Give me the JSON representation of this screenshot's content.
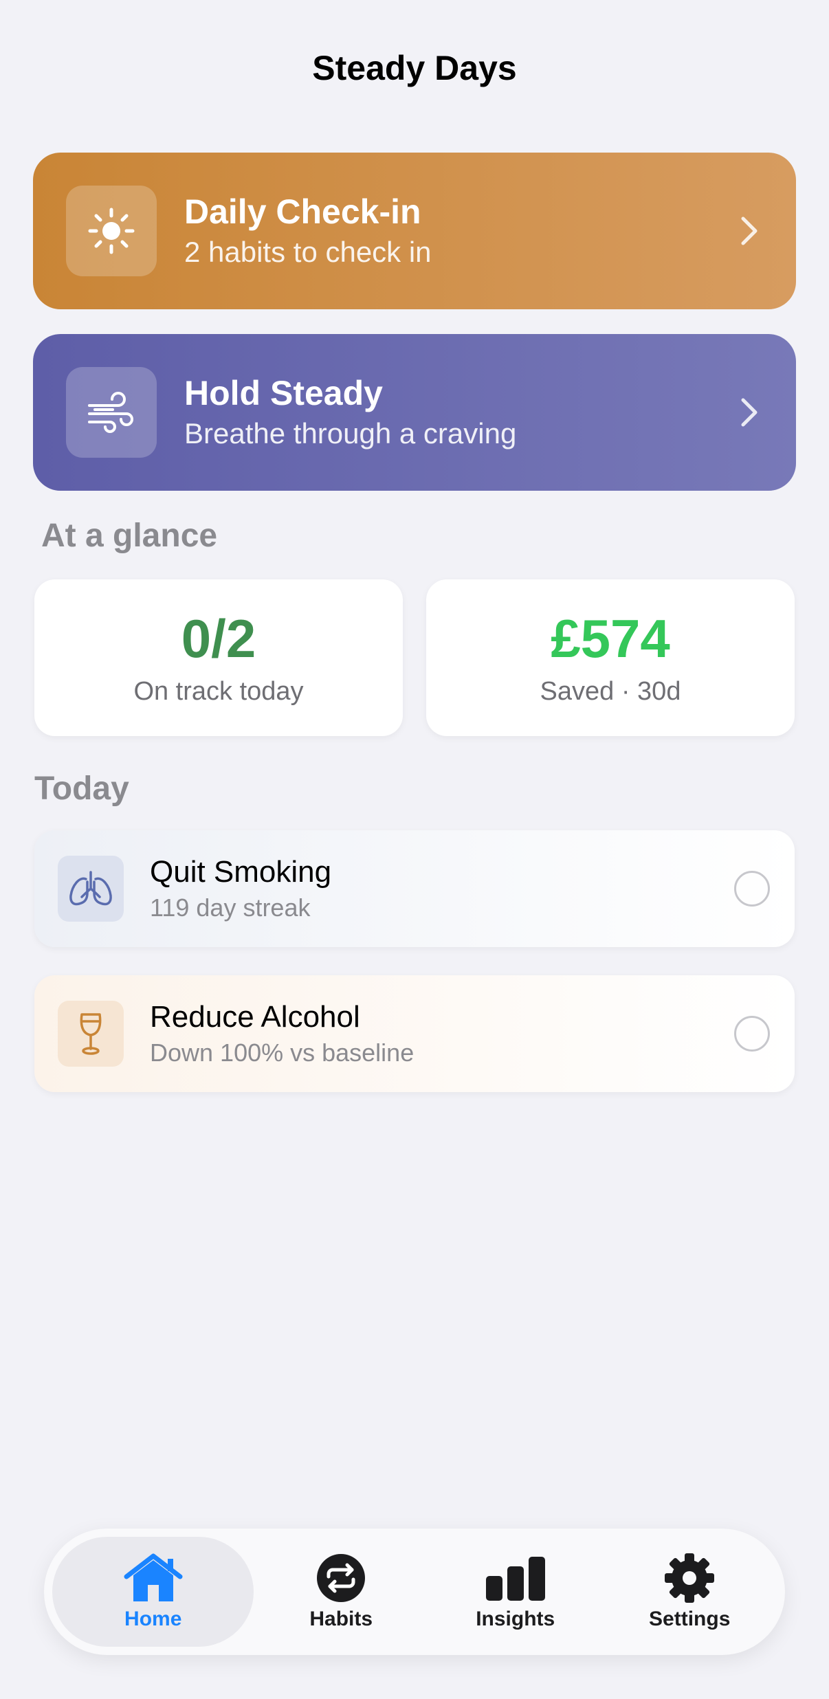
{
  "header": {
    "title": "Steady Days"
  },
  "cards": {
    "checkin": {
      "title": "Daily Check-in",
      "subtitle": "2 habits to check in",
      "icon": "sun-icon"
    },
    "hold": {
      "title": "Hold Steady",
      "subtitle": "Breathe through a craving",
      "icon": "wind-icon"
    }
  },
  "glance": {
    "label": "At a glance",
    "on_track": {
      "value": "0/2",
      "caption": "On track today",
      "color": "#3F8F4F"
    },
    "saved": {
      "value": "£574",
      "caption": "Saved · 30d",
      "color": "#34C759"
    }
  },
  "today": {
    "label": "Today",
    "habits": [
      {
        "name": "Quit Smoking",
        "detail": "119 day streak",
        "icon": "lungs-icon"
      },
      {
        "name": "Reduce Alcohol",
        "detail": "Down 100% vs baseline",
        "icon": "wine-glass-icon"
      }
    ]
  },
  "tabs": [
    {
      "label": "Home",
      "icon": "house-icon",
      "active": true
    },
    {
      "label": "Habits",
      "icon": "repeat-icon",
      "active": false
    },
    {
      "label": "Insights",
      "icon": "bar-chart-icon",
      "active": false
    },
    {
      "label": "Settings",
      "icon": "gear-icon",
      "active": false
    }
  ],
  "colors": {
    "accent_blue": "#1A84FF",
    "checkin_card": "#CF8F4C",
    "hold_card": "#6A6BB0",
    "background": "#F2F2F7"
  }
}
